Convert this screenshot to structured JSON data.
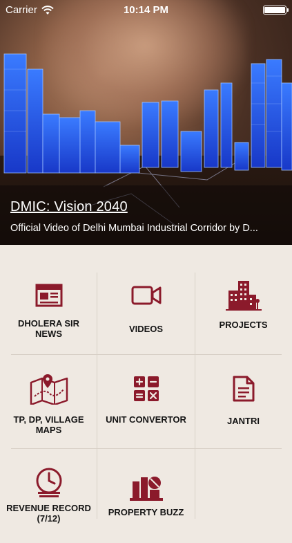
{
  "status_bar": {
    "carrier": "Carrier",
    "time": "10:14 PM"
  },
  "hero": {
    "title": "DMIC: Vision 2040",
    "description": "Official Video of Delhi Mumbai Industrial Corridor by D..."
  },
  "tiles": [
    {
      "label": "DHOLERA SIR NEWS",
      "icon": "newspaper-icon"
    },
    {
      "label": "VIDEOS",
      "icon": "video-camera-icon"
    },
    {
      "label": "PROJECTS",
      "icon": "buildings-icon"
    },
    {
      "label": "TP, DP, VILLAGE MAPS",
      "icon": "map-pin-icon"
    },
    {
      "label": "UNIT CONVERTOR",
      "icon": "calculator-icon"
    },
    {
      "label": "JANTRI",
      "icon": "document-icon"
    },
    {
      "label": "REVENUE RECORD (7/12)",
      "icon": "clock-records-icon"
    },
    {
      "label": "PROPERTY BUZZ",
      "icon": "property-buzz-icon"
    },
    {
      "label": "",
      "icon": ""
    }
  ],
  "colors": {
    "accent": "#8b1a2b",
    "background": "#efe9e2",
    "divider": "#d8d0c7"
  }
}
